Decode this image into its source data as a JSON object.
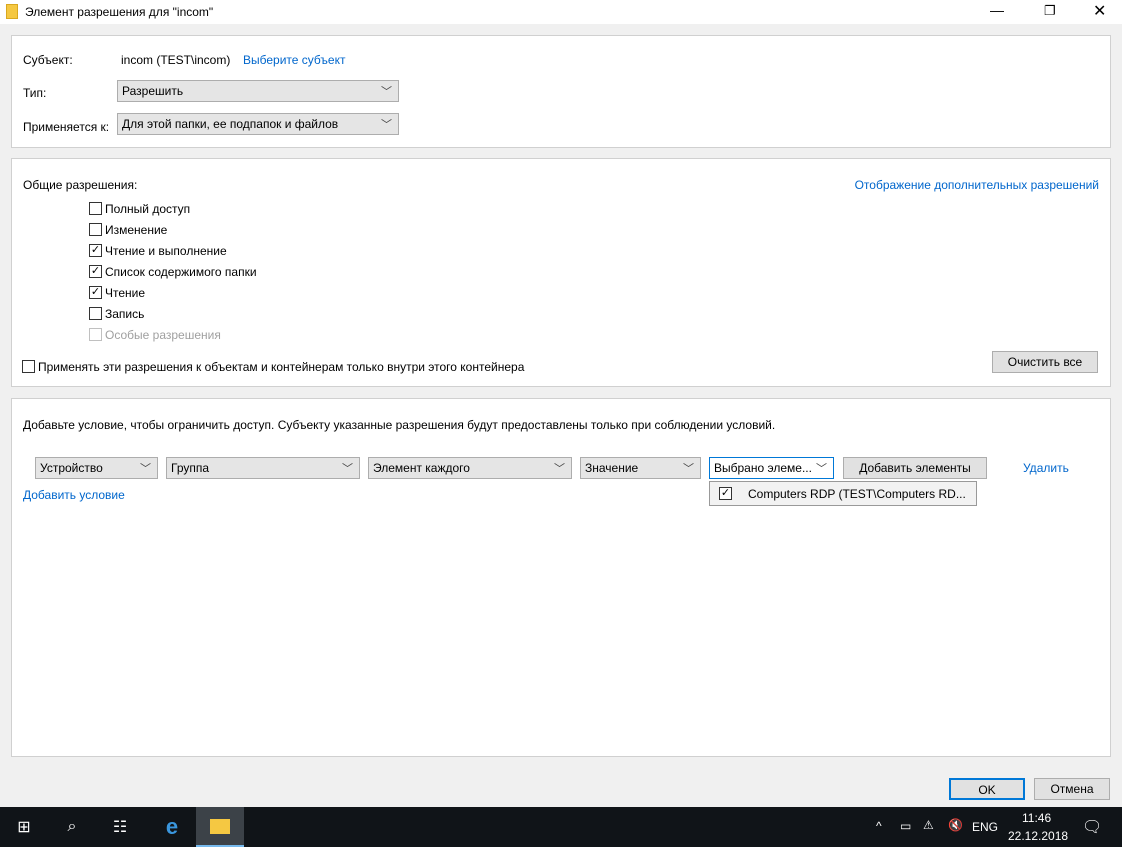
{
  "window": {
    "title": "Элемент разрешения для \"incom\""
  },
  "principal": {
    "label": "Субъект:",
    "value": "incom (TEST\\incom)",
    "select_link": "Выберите субъект"
  },
  "type": {
    "label": "Тип:",
    "value": "Разрешить"
  },
  "applies": {
    "label": "Применяется к:",
    "value": "Для этой папки, ее подпапок и файлов"
  },
  "permissions": {
    "label": "Общие разрешения:",
    "advanced_link": "Отображение дополнительных разрешений",
    "items": [
      {
        "label": "Полный доступ",
        "checked": false,
        "disabled": false
      },
      {
        "label": "Изменение",
        "checked": false,
        "disabled": false
      },
      {
        "label": "Чтение и выполнение",
        "checked": true,
        "disabled": false
      },
      {
        "label": "Список содержимого папки",
        "checked": true,
        "disabled": false
      },
      {
        "label": "Чтение",
        "checked": true,
        "disabled": false
      },
      {
        "label": "Запись",
        "checked": false,
        "disabled": false
      },
      {
        "label": "Особые разрешения",
        "checked": false,
        "disabled": true
      }
    ],
    "apply_inside": "Применять эти разрешения к объектам и контейнерам только внутри этого контейнера",
    "clear_all": "Очистить все"
  },
  "conditions": {
    "description": "Добавьте условие, чтобы ограничить доступ. Субъекту указанные разрешения будут предоставлены только при соблюдении условий.",
    "row": [
      "Устройство",
      "Группа",
      "Элемент каждого",
      "Значение",
      "Выбрано элеме..."
    ],
    "add_items": "Добавить элементы",
    "delete": "Удалить",
    "add_condition": "Добавить условие",
    "dropdown_item": "Computers RDP (TEST\\Computers RD..."
  },
  "footer": {
    "ok": "OK",
    "cancel": "Отмена"
  },
  "taskbar": {
    "lang": "ENG",
    "time": "11:46",
    "date": "22.12.2018"
  }
}
